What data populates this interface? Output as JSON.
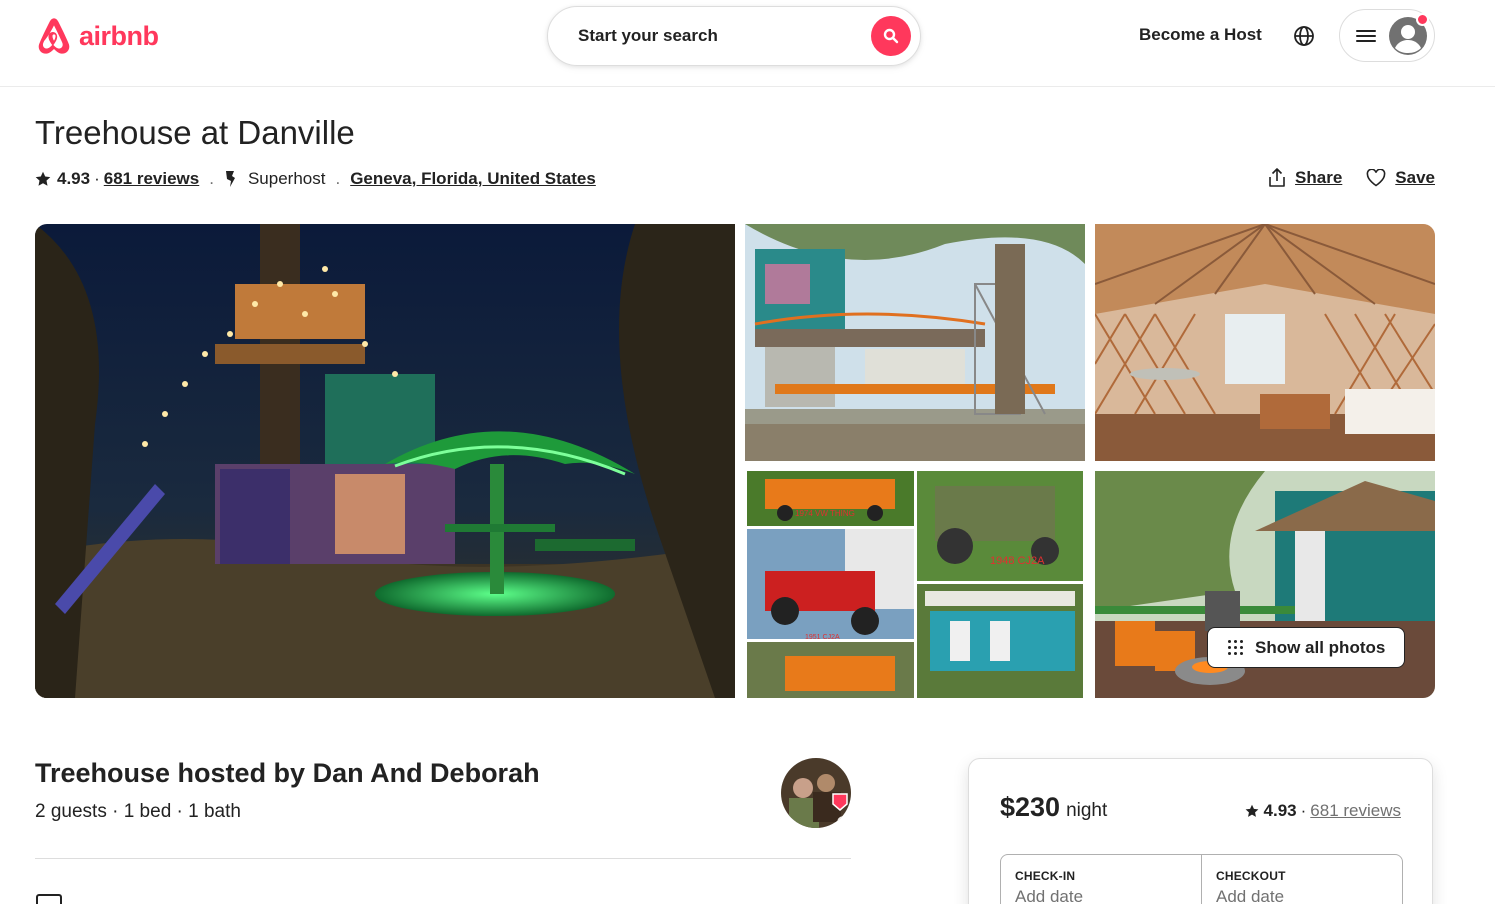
{
  "header": {
    "logo_text": "airbnb",
    "search_placeholder": "Start your search",
    "become_host": "Become a Host",
    "brand_color": "#ff385c"
  },
  "listing": {
    "title": "Treehouse at Danville",
    "rating": "4.93",
    "reviews_link": "681 reviews",
    "host_badge": "Superhost",
    "location": "Geneva, Florida, United States",
    "share_label": "Share",
    "save_label": "Save"
  },
  "gallery": {
    "show_all_label": "Show all photos",
    "photos": [
      "treehouse-night",
      "treehouse-day",
      "yurt-interior",
      "vehicles-collage",
      "deck-firepit"
    ],
    "collage_captions": [
      "1974 VW THING",
      "1948 CJ2A",
      "1951 CJ2A"
    ]
  },
  "host": {
    "title": "Treehouse hosted by Dan And Deborah",
    "details": "2 guests · 1 bed · 1 bath"
  },
  "booking": {
    "price": "$230",
    "price_unit": "night",
    "rating": "4.93",
    "reviews": "681 reviews",
    "checkin_label": "CHECK-IN",
    "checkin_value": "Add date",
    "checkout_label": "CHECKOUT",
    "checkout_value": "Add date"
  }
}
